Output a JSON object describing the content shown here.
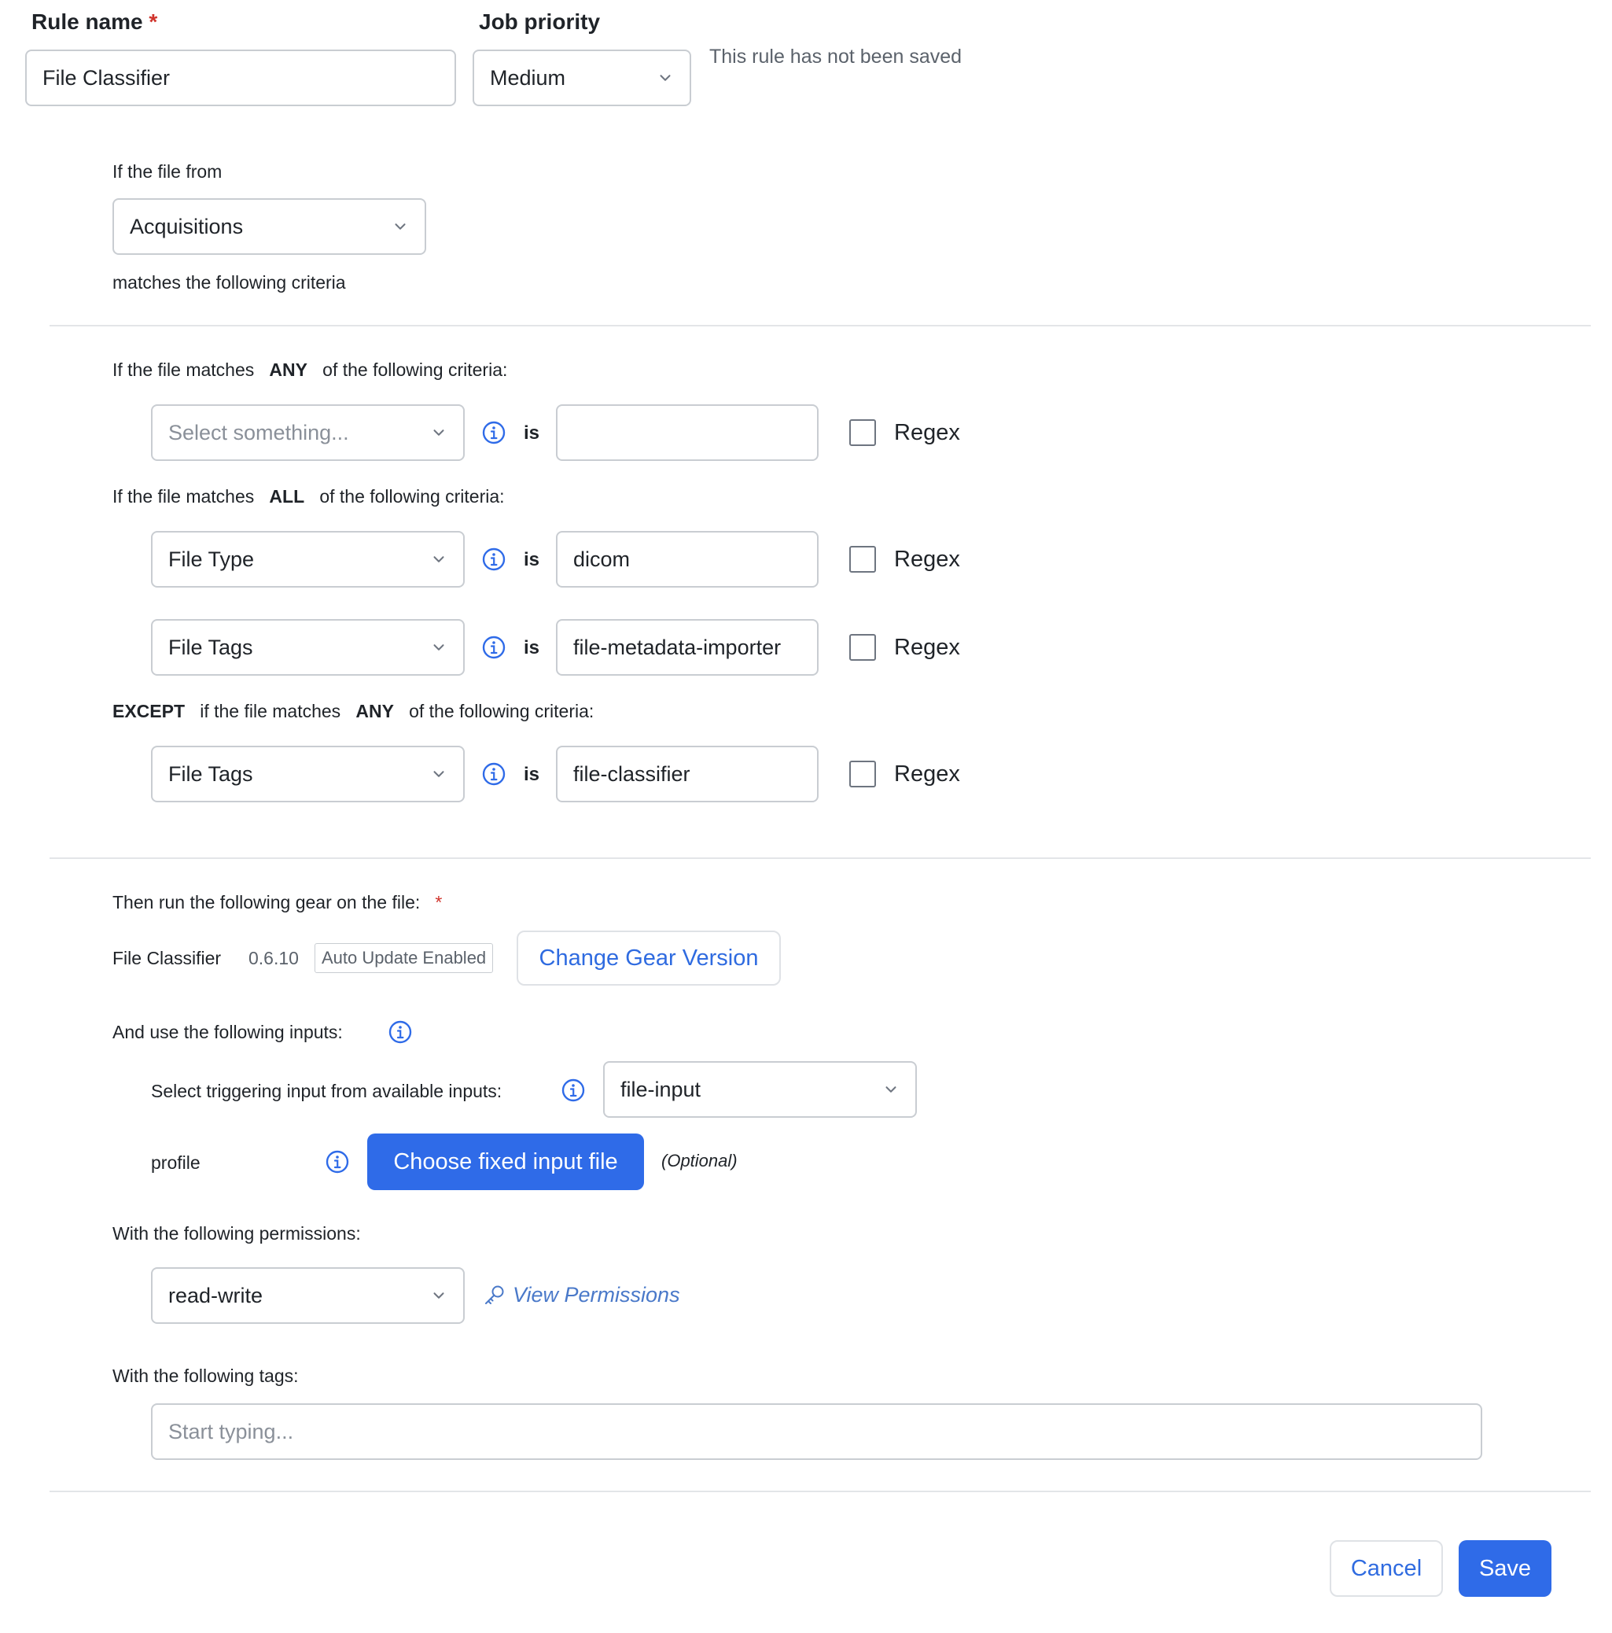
{
  "header": {
    "rule_name_label": "Rule name",
    "required_mark": "*",
    "rule_name_value": "File Classifier",
    "job_priority_label": "Job priority",
    "job_priority_value": "Medium",
    "save_status": "This rule has not been saved"
  },
  "source": {
    "intro": "If the file from",
    "container_value": "Acquisitions",
    "outro": "matches the following criteria"
  },
  "criteria": {
    "any_prefix": "If the file matches",
    "any_keyword": "ANY",
    "any_suffix": "of the following criteria:",
    "any_rows": [
      {
        "field_placeholder": "Select something...",
        "operator": "is",
        "value": "",
        "regex_label": "Regex",
        "regex_checked": false
      }
    ],
    "all_prefix": "If the file matches",
    "all_keyword": "ALL",
    "all_suffix": "of the following criteria:",
    "all_rows": [
      {
        "field": "File Type",
        "operator": "is",
        "value": "dicom",
        "regex_label": "Regex",
        "regex_checked": false
      },
      {
        "field": "File Tags",
        "operator": "is",
        "value": "file-metadata-importer",
        "regex_label": "Regex",
        "regex_checked": false
      }
    ],
    "except_keyword": "EXCEPT",
    "except_middle": "if the file matches",
    "except_any_keyword": "ANY",
    "except_suffix": "of the following criteria:",
    "except_rows": [
      {
        "field": "File Tags",
        "operator": "is",
        "value": "file-classifier",
        "regex_label": "Regex",
        "regex_checked": false
      }
    ]
  },
  "gear": {
    "section_label": "Then run the following gear on the file:",
    "required_mark": "*",
    "name": "File Classifier",
    "version": "0.6.10",
    "auto_update_badge": "Auto Update Enabled",
    "change_version_button": "Change Gear Version"
  },
  "inputs": {
    "section_label": "And use the following inputs:",
    "triggering_label": "Select triggering input from available inputs:",
    "triggering_value": "file-input",
    "profile_label": "profile",
    "choose_file_button": "Choose fixed input file",
    "optional_note": "(Optional)"
  },
  "permissions": {
    "section_label": "With the following permissions:",
    "value": "read-write",
    "view_link": "View Permissions"
  },
  "tags": {
    "section_label": "With the following tags:",
    "placeholder": "Start typing..."
  },
  "footer": {
    "cancel_button": "Cancel",
    "save_button": "Save"
  },
  "colors": {
    "accent": "#2f6be8",
    "required": "#d0342c",
    "border": "#c9cdd2",
    "divider": "#e3e5e8"
  },
  "icons": {
    "dropdown": "chevron-down-icon",
    "info": "info-icon",
    "permissions": "key-icon"
  }
}
